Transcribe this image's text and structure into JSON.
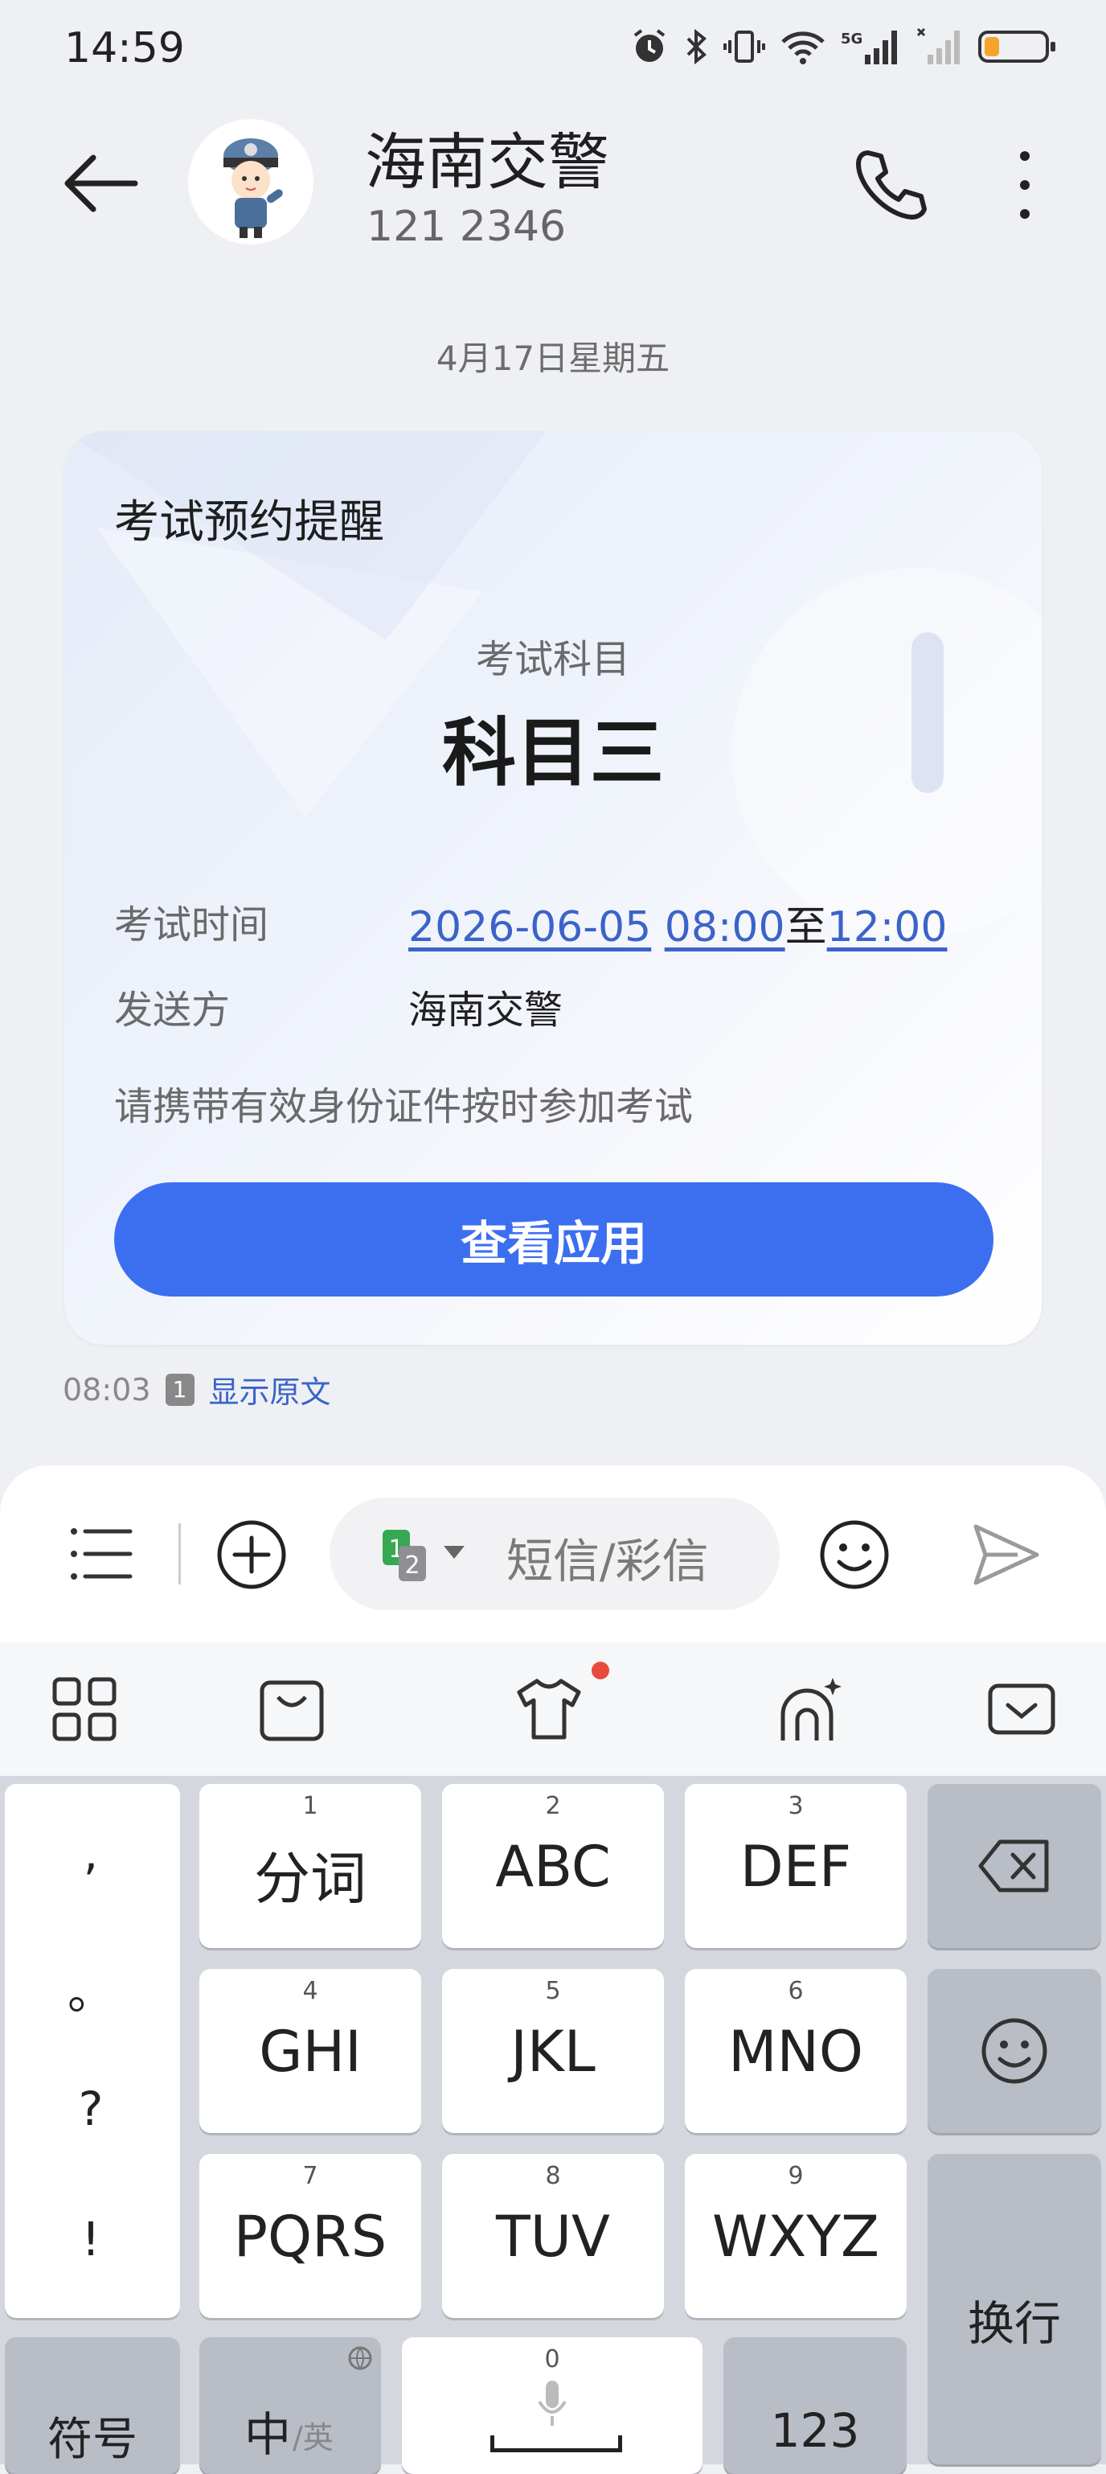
{
  "status_bar": {
    "time": "14:59",
    "signal_label": "5G",
    "battery_color": "#f4a42a"
  },
  "header": {
    "contact_name": "海南交警",
    "contact_number": "121 2346"
  },
  "date_label": "4月17日星期五",
  "card": {
    "title": "考试预约提醒",
    "subject_label": "考试科目",
    "subject_value": "科目三",
    "time_label": "考试时间",
    "time_date": "2026-06-05",
    "time_start": "08:00",
    "time_to": "至",
    "time_end": "12:00",
    "sender_label": "发送方",
    "sender_value": "海南交警",
    "note": "请携带有效身份证件按时参加考试",
    "button_label": "查看应用",
    "accent": "#3c6ef0"
  },
  "message_meta": {
    "time": "08:03",
    "sim": "1",
    "show_original": "显示原文"
  },
  "compose": {
    "placeholder": "短信/彩信",
    "sim_primary": "1",
    "sim_secondary": "2"
  },
  "keyboard": {
    "punctuation": [
      ",",
      "。",
      "?",
      "!"
    ],
    "keys": [
      {
        "num": "1",
        "label": "分词"
      },
      {
        "num": "2",
        "label": "ABC"
      },
      {
        "num": "3",
        "label": "DEF"
      },
      {
        "num": "4",
        "label": "GHI"
      },
      {
        "num": "5",
        "label": "JKL"
      },
      {
        "num": "6",
        "label": "MNO"
      },
      {
        "num": "7",
        "label": "PQRS"
      },
      {
        "num": "8",
        "label": "TUV"
      },
      {
        "num": "9",
        "label": "WXYZ"
      }
    ],
    "enter_label": "换行",
    "symbol_label": "符号",
    "lang_main": "中",
    "lang_alt": "/英",
    "space_num": "0",
    "num_label": "123"
  }
}
